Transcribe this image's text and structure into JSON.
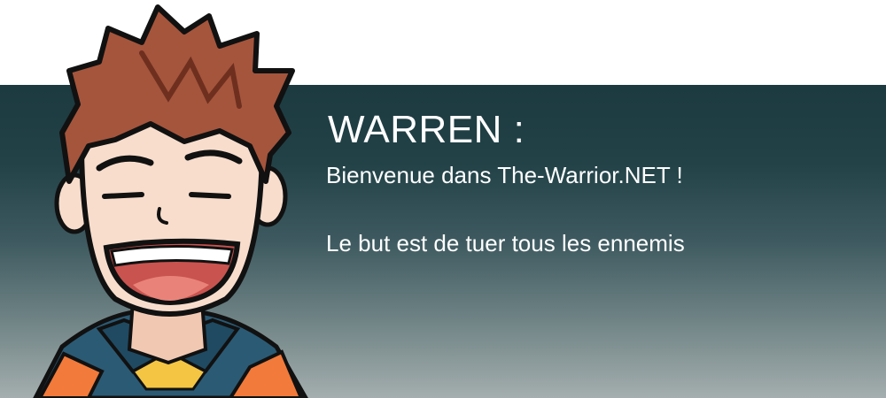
{
  "dialog": {
    "speaker": "WARREN :",
    "lines": [
      "Bienvenue dans The-Warrior.NET !",
      "Le but est de tuer tous les ennemis"
    ]
  },
  "colors": {
    "panel_top": "#1c3a40",
    "panel_bottom": "#a4aeae",
    "text": "#ffffff",
    "hair": "#a5553c",
    "skin": "#f8ddcc",
    "mouth": "#c9534f",
    "jacket": "#2b5a74",
    "shirt_accent": "#f27a3a"
  },
  "character": {
    "icon": "warren-portrait-icon"
  }
}
